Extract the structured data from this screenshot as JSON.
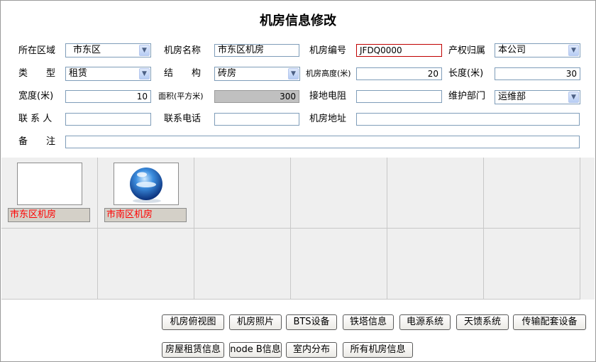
{
  "title": "机房信息修改",
  "form": {
    "region": {
      "label": "所在区域",
      "value": "市东区"
    },
    "room_name": {
      "label": "机房名称",
      "value": "市东区机房"
    },
    "room_code": {
      "label": "机房编号",
      "value": "JFDQ0000"
    },
    "ownership": {
      "label": "产权归属",
      "value": "本公司"
    },
    "type": {
      "label": "类　　型",
      "value": "租赁"
    },
    "structure": {
      "label": "结　　构",
      "value": "砖房"
    },
    "room_height": {
      "label": "机房高度(米)",
      "value": "20"
    },
    "length": {
      "label": "长度(米)",
      "value": "30"
    },
    "width": {
      "label": "宽度(米)",
      "value": "10"
    },
    "area": {
      "label": "面积(平方米)",
      "value": "300"
    },
    "ground_resistance": {
      "label": "接地电阻",
      "value": ""
    },
    "maintenance_dept": {
      "label": "维护部门",
      "value": "运维部"
    },
    "contact": {
      "label": "联 系 人",
      "value": ""
    },
    "phone": {
      "label": "联系电话",
      "value": ""
    },
    "address": {
      "label": "机房地址",
      "value": ""
    },
    "remark": {
      "label": "备　　注",
      "value": ""
    }
  },
  "rooms": [
    {
      "name": "市东区机房",
      "icon": "blank-thumbnail"
    },
    {
      "name": "市南区机房",
      "icon": "blue-sphere-icon"
    }
  ],
  "buttons": {
    "row1": [
      "机房俯视图",
      "机房照片",
      "BTS设备",
      "铁塔信息",
      "电源系统",
      "天馈系统",
      "传输配套设备"
    ],
    "row2": [
      "房屋租赁信息",
      "node B信息",
      "室内分布",
      "所有机房信息"
    ]
  },
  "colors": {
    "caption_text": "#ff0000",
    "code_border": "#c00000",
    "area_background": "#c0c0c0"
  }
}
